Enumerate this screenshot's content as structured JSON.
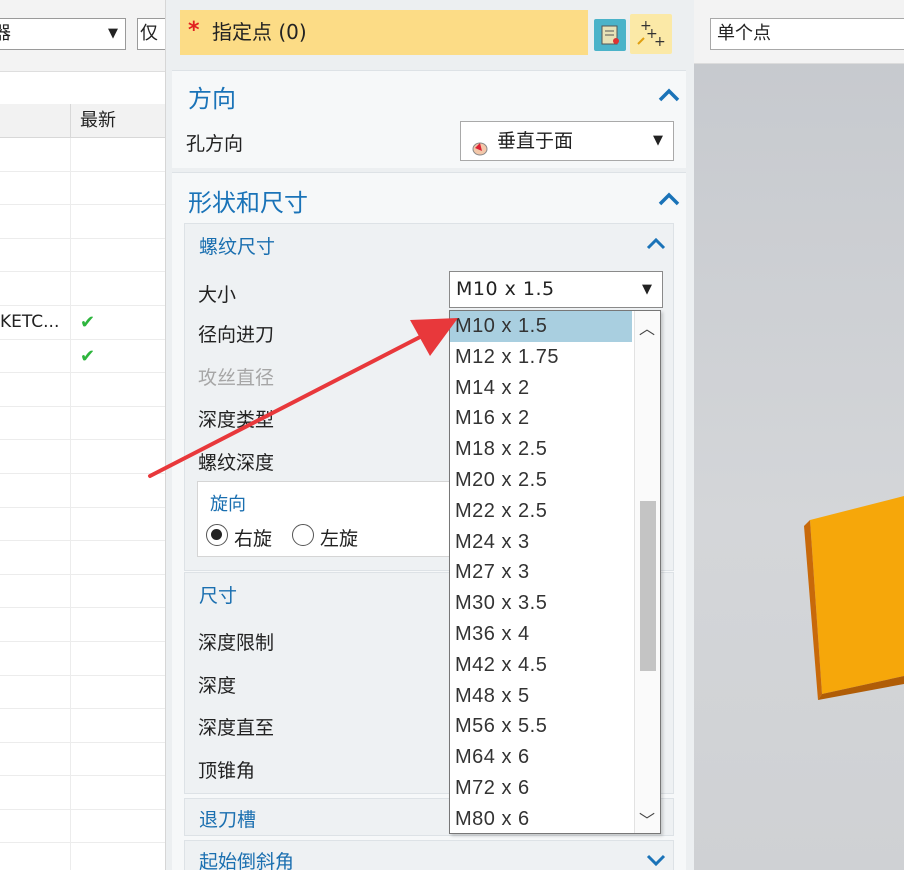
{
  "navigator": {
    "filter_combo_text": "器",
    "filter_combo2_text": "仅",
    "column_header": "最新",
    "rows": [
      {
        "name": "",
        "status": ""
      },
      {
        "name": "",
        "status": ""
      },
      {
        "name": "",
        "status": ""
      },
      {
        "name": "",
        "status": ""
      },
      {
        "name": "",
        "status": ""
      },
      {
        "name": "KETC...",
        "status": "✔"
      },
      {
        "name": "",
        "status": "✔"
      },
      {
        "name": "",
        "status": ""
      },
      {
        "name": "",
        "status": ""
      },
      {
        "name": "",
        "status": ""
      },
      {
        "name": "",
        "status": ""
      },
      {
        "name": "",
        "status": ""
      },
      {
        "name": "",
        "status": ""
      },
      {
        "name": "",
        "status": ""
      },
      {
        "name": "",
        "status": ""
      },
      {
        "name": "",
        "status": ""
      },
      {
        "name": "",
        "status": ""
      },
      {
        "name": "",
        "status": ""
      },
      {
        "name": "",
        "status": ""
      },
      {
        "name": "",
        "status": ""
      },
      {
        "name": "",
        "status": ""
      },
      {
        "name": "",
        "status": ""
      }
    ]
  },
  "dialog": {
    "specify_point_label": "指定点 (0)",
    "direction": {
      "title": "方向",
      "hole_direction_label": "孔方向",
      "hole_direction_value": "垂直于面"
    },
    "shape_size": {
      "title": "形状和尺寸",
      "thread_size_title": "螺纹尺寸",
      "size_label": "大小",
      "size_value": "M10 x 1.5",
      "radial_engage_label": "径向进刀",
      "tap_drill_label": "攻丝直径",
      "depth_type_label": "深度类型",
      "thread_depth_label": "螺纹深度",
      "rotation_title": "旋向",
      "right_hand": "右旋",
      "left_hand": "左旋",
      "dimensions_title": "尺寸",
      "depth_limit_label": "深度限制",
      "depth_label": "深度",
      "depth_up_to_label": "深度直至",
      "tip_angle_label": "顶锥角",
      "relief_title": "退刀槽",
      "start_chamfer_title": "起始倒斜角"
    }
  },
  "size_options": [
    "M10 x 1.5",
    "M12 x 1.75",
    "M14 x 2",
    "M16 x 2",
    "M18 x 2.5",
    "M20 x 2.5",
    "M22 x 2.5",
    "M24 x 3",
    "M27 x 3",
    "M30 x 3.5",
    "M36 x 4",
    "M42 x 4.5",
    "M48 x 5",
    "M56 x 5.5",
    "M64 x 6",
    "M72 x 6",
    "M80 x 6"
  ],
  "selected_option": "M10 x 1.5",
  "graphics": {
    "point_type": "单个点"
  },
  "colors": {
    "accent": "#1a73b8",
    "point_bar": "#fcdc86",
    "selection": "#a9cfe0",
    "arrow": "#e8383b",
    "model": "#f6a70a"
  },
  "icons": {
    "required": "asterisk-icon",
    "point_dialog": "point-dialog-icon",
    "point_constructor": "point-constructor-icon",
    "face_normal": "face-normal-icon",
    "collapse": "chevron-up-icon",
    "expand": "chevron-down-icon"
  }
}
